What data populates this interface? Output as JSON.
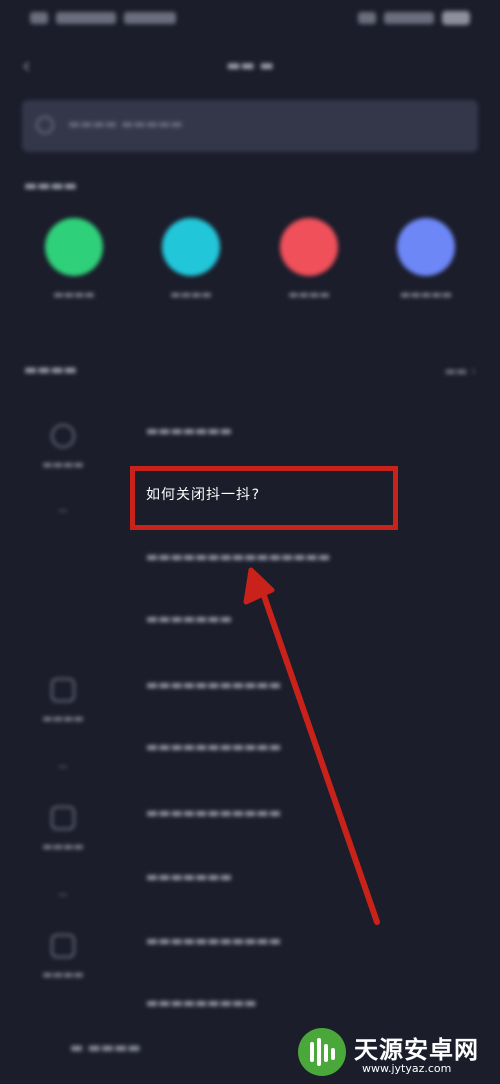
{
  "status_bar": {
    "icons": [
      "signal-icon",
      "wifi-icon",
      "battery-icon"
    ]
  },
  "header": {
    "back_icon": "back-arrow-icon"
  },
  "quick_actions": [
    {
      "icon": "green-circle-icon",
      "color": "#2fd07a"
    },
    {
      "icon": "cyan-circle-icon",
      "color": "#22c6d9"
    },
    {
      "icon": "red-circle-icon",
      "color": "#f0505a"
    },
    {
      "icon": "blue-circle-icon",
      "color": "#6d87f7"
    }
  ],
  "highlighted_question": "如何关闭抖一抖?",
  "annotation": {
    "highlight_color": "#c8221a"
  },
  "watermark": {
    "title": "天源安卓网",
    "url": "www.jytyaz.com"
  }
}
